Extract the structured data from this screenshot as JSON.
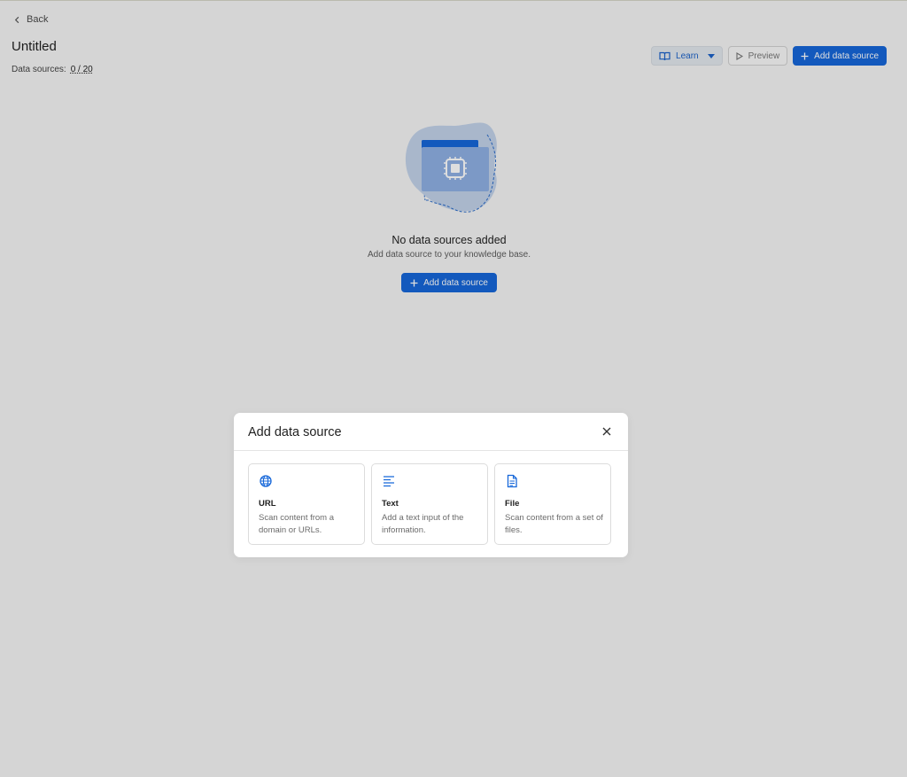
{
  "header": {
    "back_label": "Back",
    "page_title": "Untitled",
    "data_sources_label": "Data sources:",
    "data_sources_count": "0 / 20"
  },
  "toolbar": {
    "learn_label": "Learn",
    "preview_label": "Preview",
    "add_label": "Add data source"
  },
  "empty_state": {
    "title": "No data sources added",
    "subtitle": "Add data source to your knowledge base.",
    "button_label": "Add data source"
  },
  "modal": {
    "title": "Add data source",
    "options": [
      {
        "title": "URL",
        "description": "Scan content from a domain or URLs.",
        "icon": "globe-icon"
      },
      {
        "title": "Text",
        "description": "Add a text input of the information.",
        "icon": "text-lines-icon"
      },
      {
        "title": "File",
        "description": "Scan content from a set of files.",
        "icon": "file-icon"
      }
    ]
  },
  "colors": {
    "primary": "#1667d9",
    "page_bg": "#f5f5f5",
    "overlay": "rgba(0,0,0,0.13)"
  }
}
